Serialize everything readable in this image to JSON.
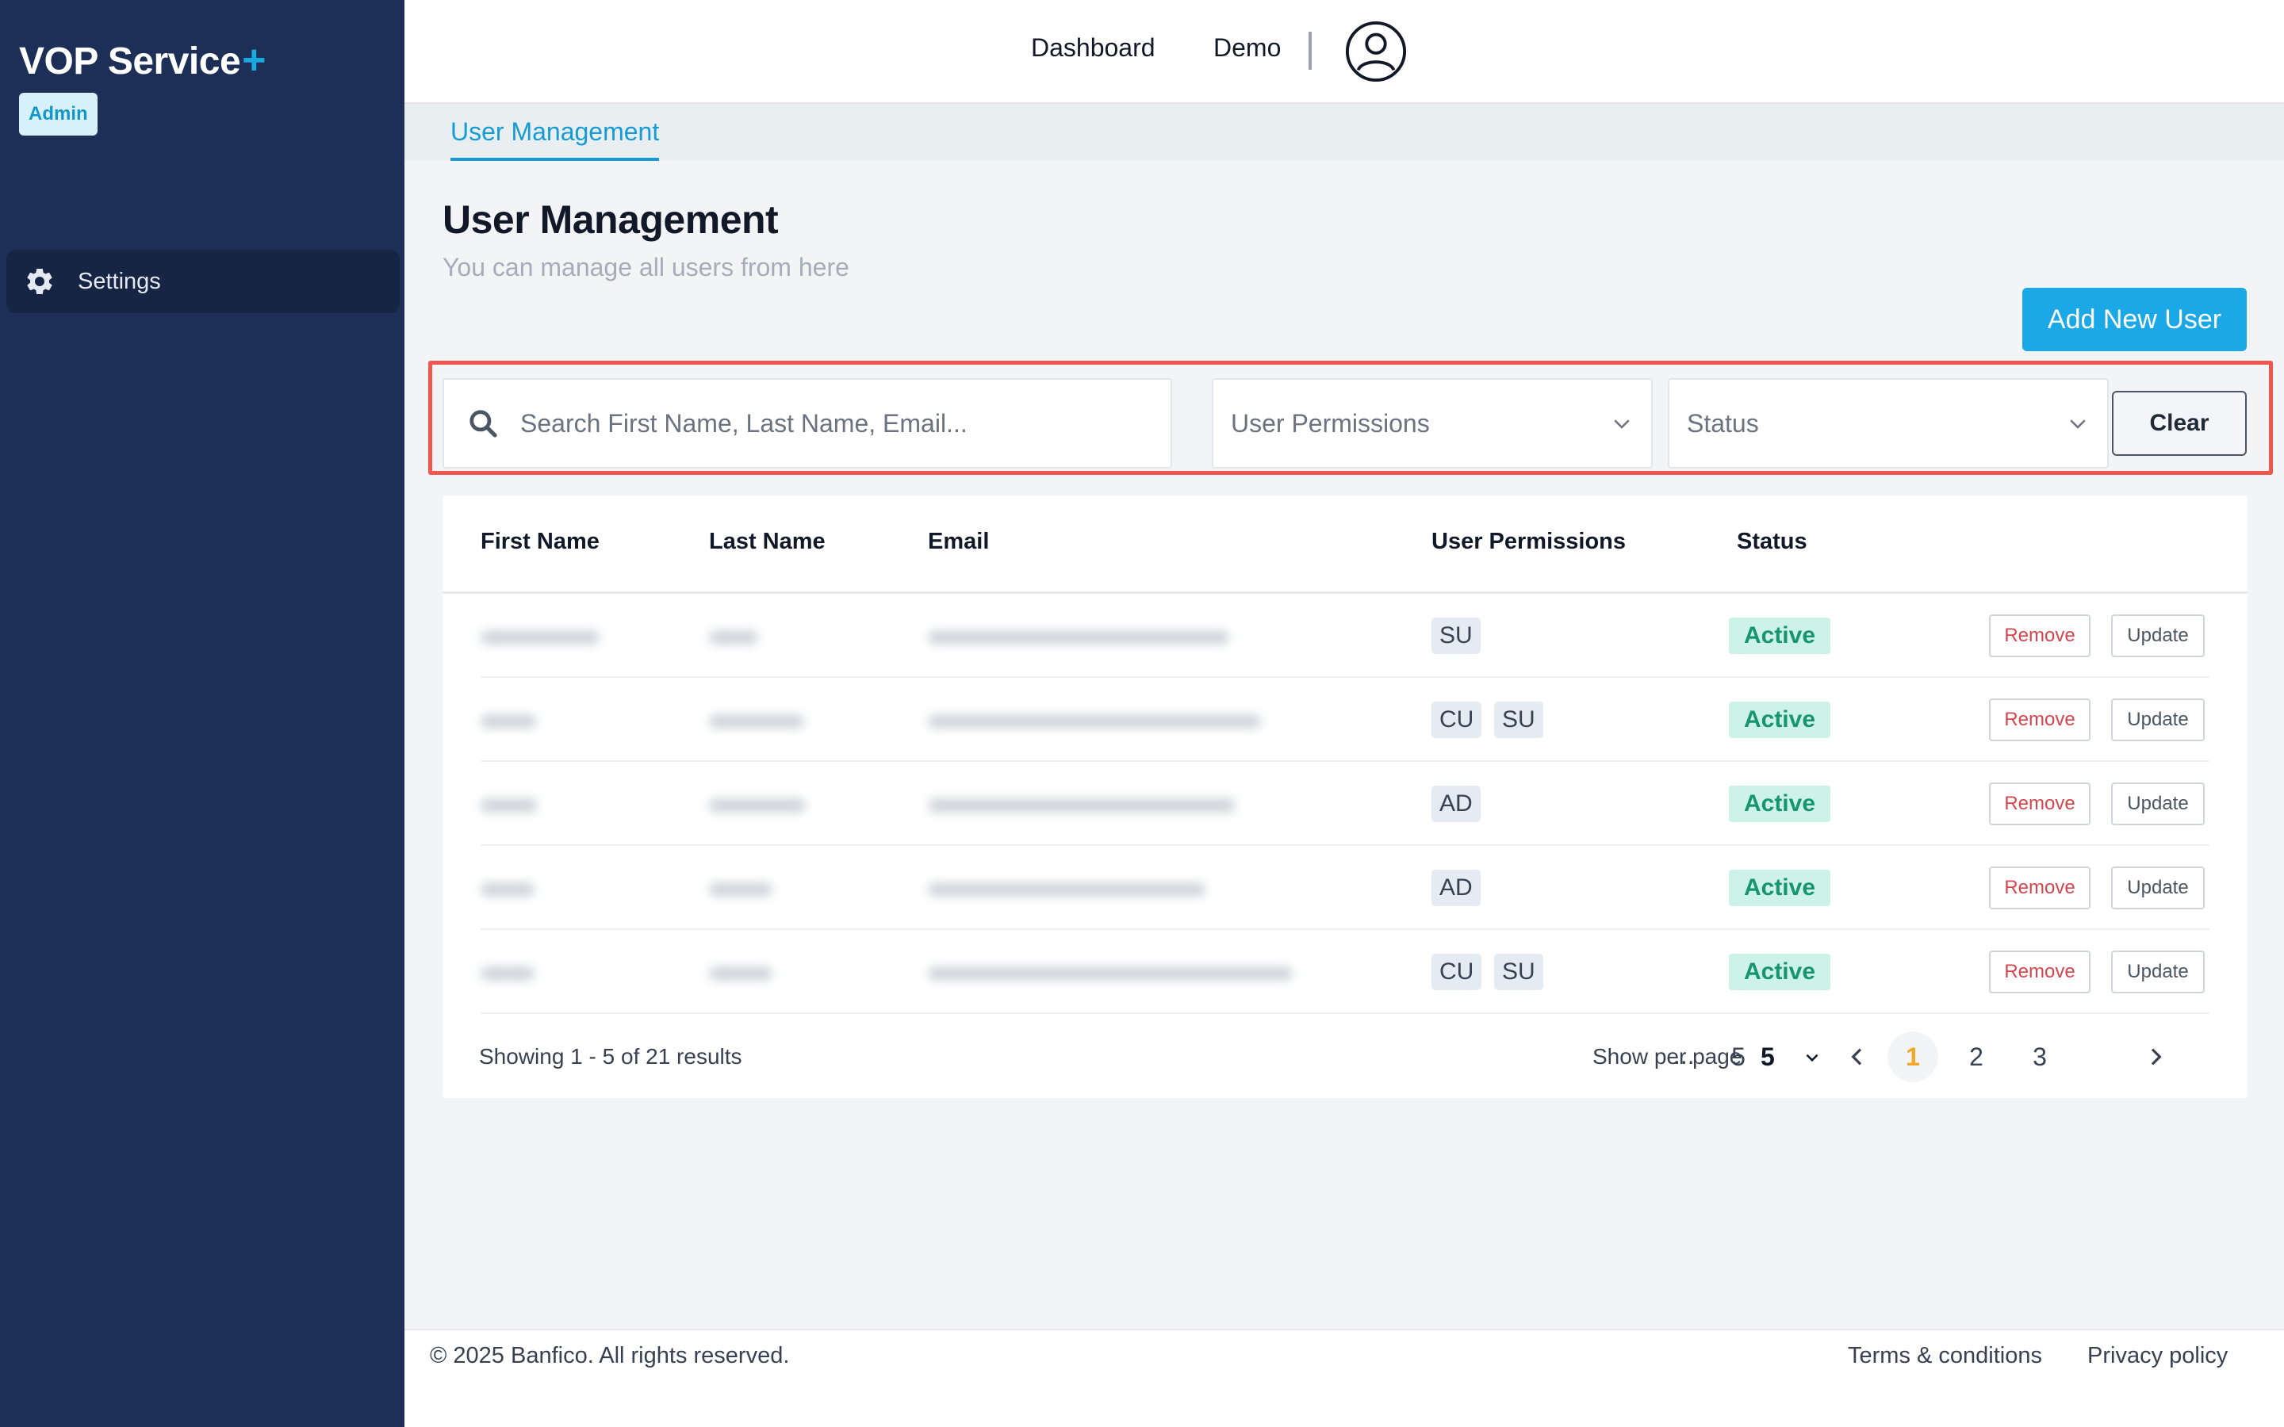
{
  "sidebar": {
    "brand": "VOP Service",
    "brand_plus": "+",
    "role_badge": "Admin",
    "items": [
      {
        "label": "Settings",
        "icon": "gear-icon"
      }
    ]
  },
  "topbar": {
    "links": [
      "Dashboard",
      "Demo"
    ],
    "avatar_icon": "user-circle-icon"
  },
  "tabs": [
    {
      "label": "User Management",
      "active": true
    }
  ],
  "page": {
    "title": "User Management",
    "subtitle": "You can manage all users from here",
    "add_button": "Add New User"
  },
  "filters": {
    "search_placeholder": "Search First Name, Last Name, Email...",
    "search_value": "",
    "permissions_select": "User Permissions",
    "status_select": "Status",
    "clear_button": "Clear"
  },
  "table": {
    "headers": [
      "First Name",
      "Last Name",
      "Email",
      "User Permissions",
      "Status"
    ],
    "rows": [
      {
        "permissions": [
          "SU"
        ],
        "status": "Active",
        "remove": "Remove",
        "update": "Update"
      },
      {
        "permissions": [
          "CU",
          "SU"
        ],
        "status": "Active",
        "remove": "Remove",
        "update": "Update"
      },
      {
        "permissions": [
          "AD"
        ],
        "status": "Active",
        "remove": "Remove",
        "update": "Update"
      },
      {
        "permissions": [
          "AD"
        ],
        "status": "Active",
        "remove": "Remove",
        "update": "Update"
      },
      {
        "permissions": [
          "CU",
          "SU"
        ],
        "status": "Active",
        "remove": "Remove",
        "update": "Update"
      }
    ]
  },
  "pagination": {
    "results_text": "Showing 1 - 5 of 21 results",
    "per_page_label": "Show per page",
    "per_page_value": "5",
    "pages": [
      "1",
      "2",
      "3",
      "5"
    ],
    "ellipsis": "...",
    "current_page": "1"
  },
  "footer": {
    "copyright": "© 2025 Banfico. All rights reserved.",
    "links": [
      "Terms & conditions",
      "Privacy policy"
    ]
  },
  "colors": {
    "sidebar_bg": "#1d2f57",
    "accent": "#1aa8e6",
    "active_status": "#16956f",
    "remove_text": "#d6454d",
    "current_page": "#f0a826",
    "highlight_frame": "#f0564d"
  }
}
